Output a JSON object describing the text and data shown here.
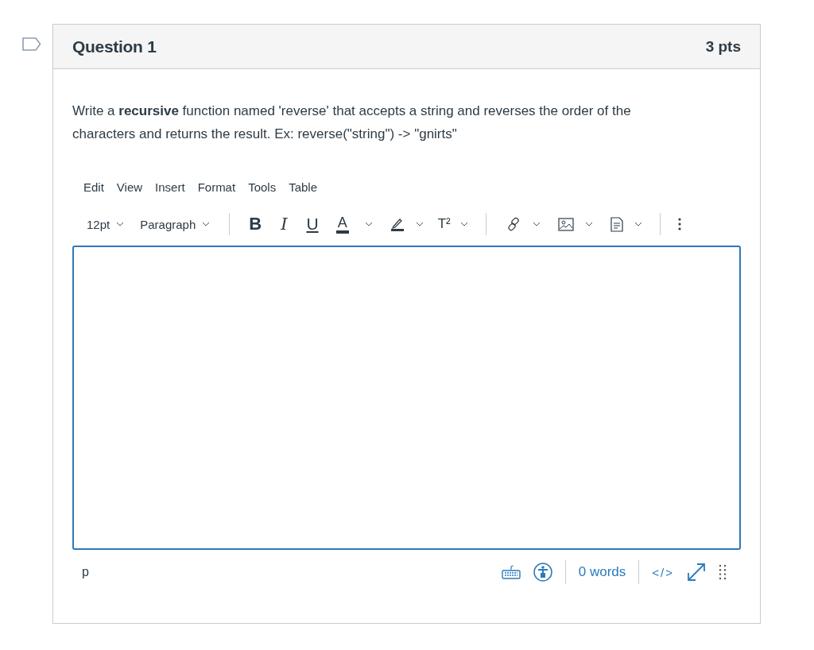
{
  "question": {
    "title": "Question 1",
    "points": "3 pts",
    "prompt": "Write a **recursive** function named 'reverse' that accepts a string and reverses the order of the characters and returns the result.  Ex: reverse(\"string\") -> \"gnirts\""
  },
  "menu": [
    "Edit",
    "View",
    "Insert",
    "Format",
    "Tools",
    "Table"
  ],
  "toolbar": {
    "font_size": "12pt",
    "block_format": "Paragraph",
    "format_buttons": [
      "B",
      "I",
      "U",
      "A"
    ],
    "superscript": "T²"
  },
  "status_bar": {
    "path": "p",
    "word_count": "0 words",
    "html_toggle": "</>"
  }
}
